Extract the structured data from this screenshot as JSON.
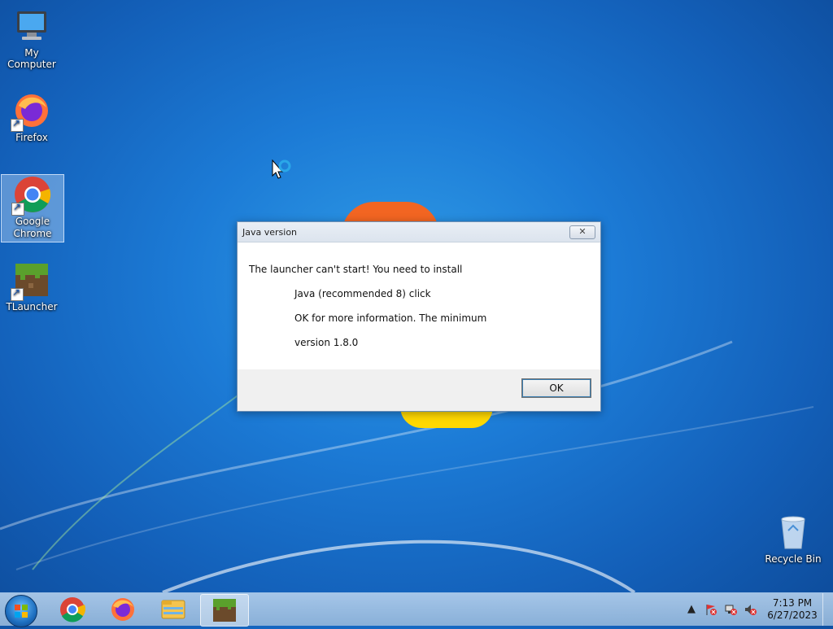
{
  "desktop": {
    "icons": [
      {
        "label": "My Computer"
      },
      {
        "label": "Firefox"
      },
      {
        "label": "Google Chrome"
      },
      {
        "label": "TLauncher"
      },
      {
        "label": "Recycle Bin"
      }
    ]
  },
  "dialog": {
    "title": "Java version",
    "close_label": "✕",
    "lines": [
      "The launcher can't start! You need to install",
      "Java (recommended 8) click",
      "OK for more information. The minimum",
      "version 1.8.0"
    ],
    "ok_label": "OK"
  },
  "taskbar": {
    "items": [
      {
        "icon": "chrome-icon"
      },
      {
        "icon": "firefox-icon"
      },
      {
        "icon": "file-explorer-icon"
      },
      {
        "icon": "tlauncher-icon"
      }
    ],
    "clock_time": "7:13 PM",
    "clock_date": "6/27/2023"
  },
  "colors": {
    "accent": "#1c7bd6",
    "dialog_border": "#6e8fb4"
  }
}
